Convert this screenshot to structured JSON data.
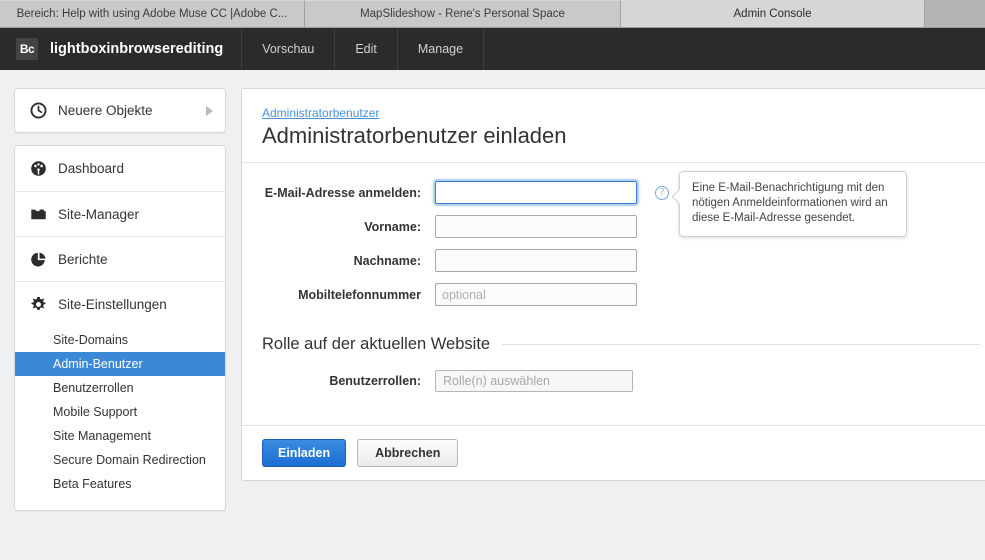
{
  "browser_tabs": [
    {
      "label": "Bereich: Help with using Adobe Muse CC |Adobe C...",
      "active": false
    },
    {
      "label": "MapSlideshow - Rene's Personal Space",
      "active": false
    },
    {
      "label": "Admin Console",
      "active": true
    }
  ],
  "appbar": {
    "logo_text": "Bc",
    "site_name": "lightboxinbrowserediting",
    "nav": [
      {
        "label": "Vorschau"
      },
      {
        "label": "Edit"
      },
      {
        "label": "Manage"
      }
    ]
  },
  "sidebar": {
    "recent": {
      "label": "Neuere Objekte",
      "icon": "clock-icon",
      "chevron": "chevron-right-icon"
    },
    "items": [
      {
        "label": "Dashboard",
        "icon": "dashboard-icon"
      },
      {
        "label": "Site-Manager",
        "icon": "folder-icon"
      },
      {
        "label": "Berichte",
        "icon": "pie-chart-icon"
      },
      {
        "label": "Site-Einstellungen",
        "icon": "gear-icon"
      }
    ],
    "subitems": [
      {
        "label": "Site-Domains",
        "active": false
      },
      {
        "label": "Admin-Benutzer",
        "active": true
      },
      {
        "label": "Benutzerrollen",
        "active": false
      },
      {
        "label": "Mobile Support",
        "active": false
      },
      {
        "label": "Site Management",
        "active": false
      },
      {
        "label": "Secure Domain Redirection",
        "active": false
      },
      {
        "label": "Beta Features",
        "active": false
      }
    ]
  },
  "main": {
    "breadcrumb": "Administratorbenutzer",
    "title": "Administratorbenutzer einladen",
    "fields": [
      {
        "label": "E-Mail-Adresse anmelden:",
        "value": "",
        "placeholder": "",
        "focused": true
      },
      {
        "label": "Vorname:",
        "value": "",
        "placeholder": "",
        "focused": false
      },
      {
        "label": "Nachname:",
        "value": "",
        "placeholder": "",
        "focused": false
      },
      {
        "label": "Mobiltelefonnummer",
        "value": "",
        "placeholder": "optional",
        "focused": false
      }
    ],
    "help": {
      "icon": "question-mark-icon",
      "tooltip": "Eine E-Mail-Benachrichtigung mit den nötigen Anmeldeinformationen wird an diese E-Mail-Adresse gesendet."
    },
    "role_section": {
      "title": "Rolle auf der aktuellen Website",
      "field_label": "Benutzerrollen:",
      "select_placeholder": "Rolle(n) auswählen"
    },
    "footer": {
      "submit_label": "Einladen",
      "cancel_label": "Abbrechen"
    }
  },
  "colors": {
    "accent": "#3b88d6",
    "link": "#4a90d9",
    "appbar_bg": "#2b2b2b",
    "page_bg": "#eff0f1"
  }
}
